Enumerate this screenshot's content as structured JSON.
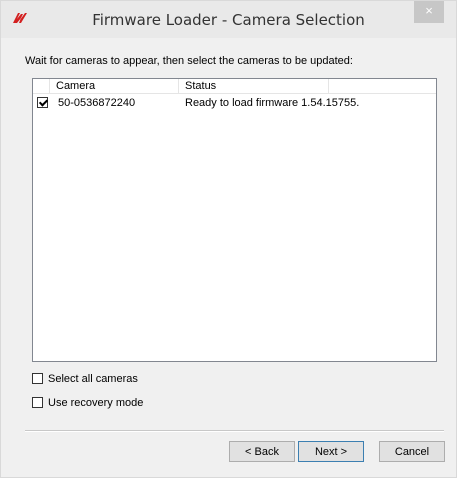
{
  "window": {
    "title": "Firmware Loader - Camera Selection",
    "close_glyph": "×",
    "app_icon": "flir-logo-icon"
  },
  "instruction": "Wait for cameras to appear, then select the cameras to be updated:",
  "camera_list": {
    "columns": [
      "Camera",
      "Status"
    ],
    "rows": [
      {
        "checked": true,
        "camera": "50-0536872240",
        "status": "Ready to load firmware 1.54.15755."
      }
    ]
  },
  "options": {
    "select_all": {
      "label": "Select all cameras",
      "checked": false
    },
    "recovery": {
      "label": "Use recovery mode",
      "checked": false
    }
  },
  "buttons": {
    "back": "< Back",
    "next": "Next >",
    "cancel": "Cancel"
  },
  "colors": {
    "accent_icon": "#d32020",
    "default_button_border": "#3c7fb1"
  }
}
